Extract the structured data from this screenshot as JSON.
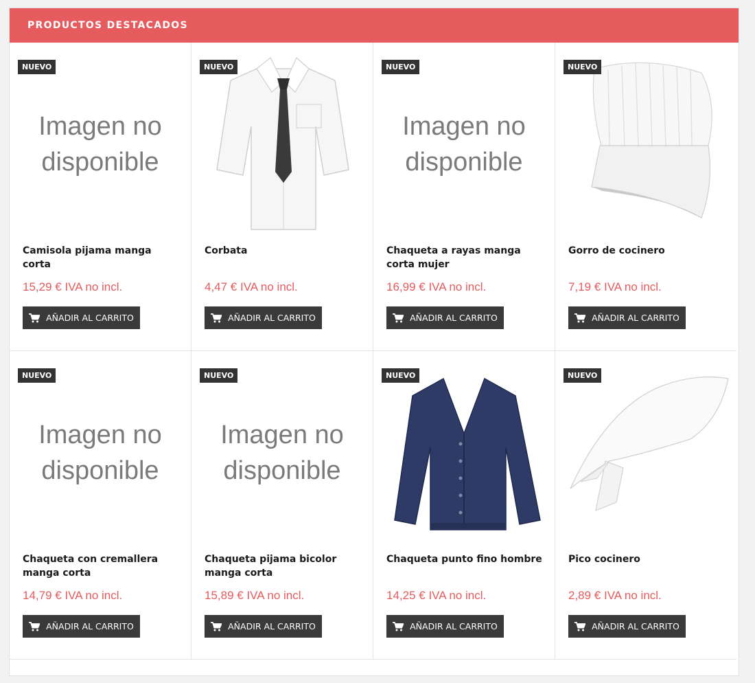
{
  "section": {
    "title": "PRODUCTOS DESTACADOS"
  },
  "products": [
    {
      "badge": "NUEVO",
      "name": "Camisola pijama manga corta",
      "price": "15,29 € IVA no incl.",
      "image": "no-image",
      "no_image_text": "Imagen no disponible",
      "button": "AÑADIR AL CARRITO"
    },
    {
      "badge": "NUEVO",
      "name": "Corbata",
      "price": "4,47 € IVA no incl.",
      "image": "shirt-tie",
      "button": "AÑADIR AL CARRITO"
    },
    {
      "badge": "NUEVO",
      "name": "Chaqueta a rayas manga corta mujer",
      "price": "16,99 € IVA no incl.",
      "image": "no-image",
      "no_image_text": "Imagen no disponible",
      "button": "AÑADIR AL CARRITO"
    },
    {
      "badge": "NUEVO",
      "name": "Gorro de cocinero",
      "price": "7,19 € IVA no incl.",
      "image": "chef-hat",
      "button": "AÑADIR AL CARRITO"
    },
    {
      "badge": "NUEVO",
      "name": "Chaqueta con cremallera manga corta",
      "price": "14,79 € IVA no incl.",
      "image": "no-image",
      "no_image_text": "Imagen no disponible",
      "button": "AÑADIR AL CARRITO"
    },
    {
      "badge": "NUEVO",
      "name": "Chaqueta pijama bicolor manga corta",
      "price": "15,89 € IVA no incl.",
      "image": "no-image",
      "no_image_text": "Imagen no disponible",
      "button": "AÑADIR AL CARRITO"
    },
    {
      "badge": "NUEVO",
      "name": "Chaqueta punto fino hombre",
      "price": "14,25 € IVA no incl.",
      "image": "cardigan",
      "button": "AÑADIR AL CARRITO"
    },
    {
      "badge": "NUEVO",
      "name": "Pico cocinero",
      "price": "2,89 € IVA no incl.",
      "image": "neckerchief",
      "button": "AÑADIR AL CARRITO"
    }
  ],
  "colors": {
    "header": "#e55b5e",
    "price": "#e55b5e",
    "button": "#3a3a3a",
    "badge": "#333333"
  },
  "icons": {
    "button_icon": "cart-icon"
  }
}
